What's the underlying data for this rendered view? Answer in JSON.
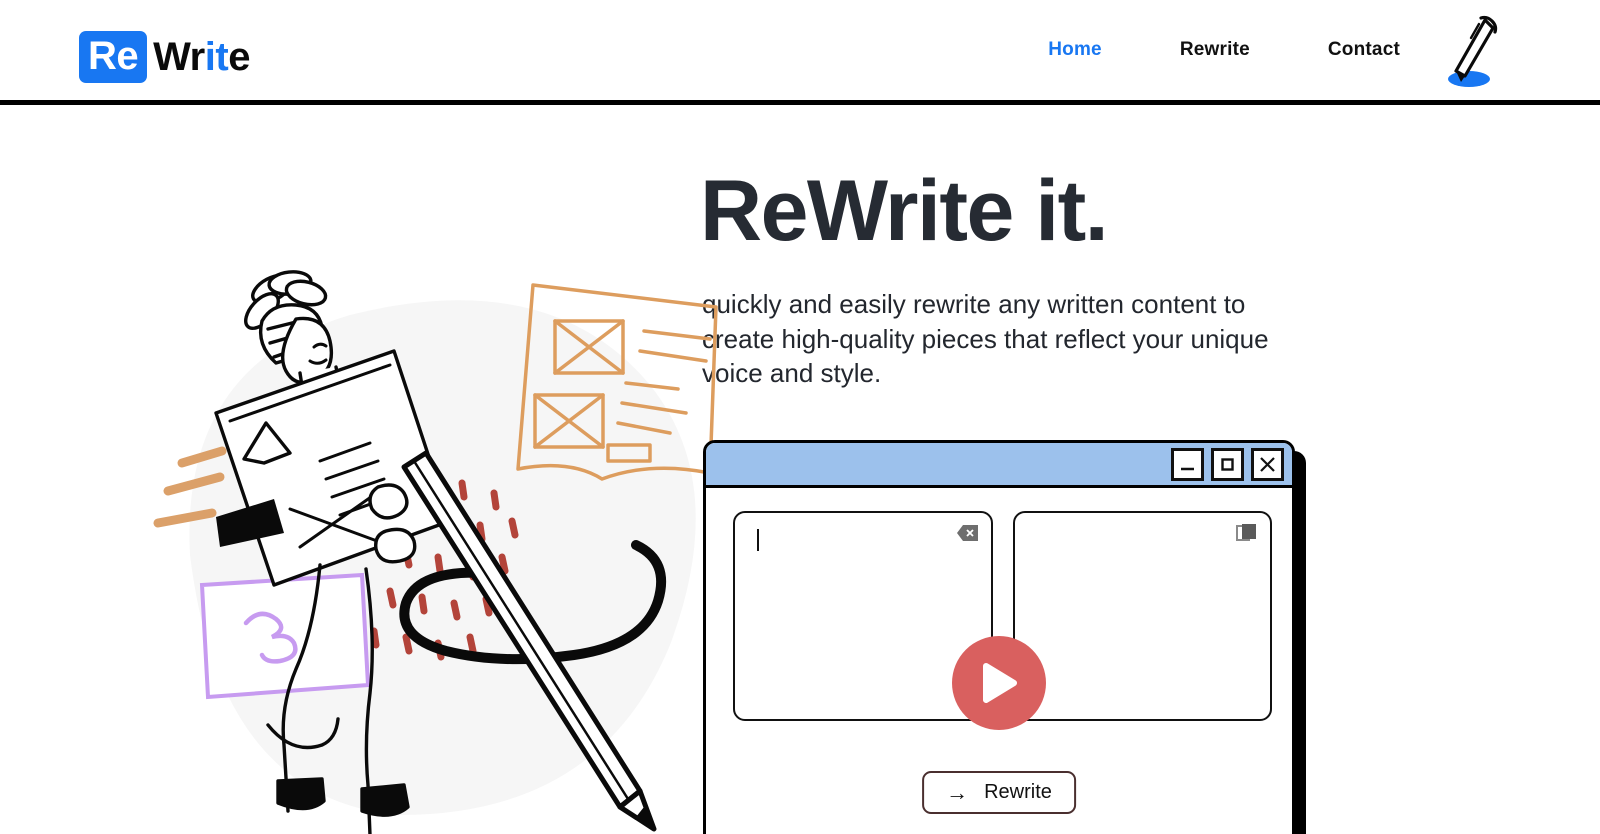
{
  "brand": {
    "badge_text": "Re",
    "name_dark_1": "Wr",
    "name_accent": "it",
    "name_dark_2": "e",
    "accent_color": "#1877f2",
    "pen_icon": "pen-icon"
  },
  "nav": {
    "items": [
      {
        "label": "Home",
        "active": true
      },
      {
        "label": "Rewrite",
        "active": false
      },
      {
        "label": "Contact",
        "active": false
      }
    ]
  },
  "hero": {
    "title": "ReWrite it.",
    "subtitle": "quickly and easily rewrite any written content to create high-quality pieces that reflect your unique voice and style.",
    "title_color": "#262b33"
  },
  "illustration": {
    "name": "woman-with-pencil-illustration",
    "blob_color": "#f6f6f6",
    "accents": {
      "speed_lines": "#dba069",
      "sticky_note": "#c79bf0",
      "paper_sketch": "#dd9d5e",
      "dashes": "#b3443a",
      "ink": "#0a0a0a"
    }
  },
  "app_window": {
    "titlebar_color": "#9cc1ec",
    "controls": [
      {
        "name": "minimize-button",
        "glyph": "minimize"
      },
      {
        "name": "maximize-button",
        "glyph": "maximize"
      },
      {
        "name": "close-button",
        "glyph": "close"
      }
    ],
    "input_panel": {
      "value": "",
      "placeholder": "",
      "icon": "clear-backspace-icon"
    },
    "output_panel": {
      "value": "",
      "placeholder": "",
      "icon": "copy-icon"
    },
    "play_button": {
      "name": "play-button",
      "color": "#d9605f"
    },
    "rewrite_button": {
      "arrow": "→",
      "label": "Rewrite",
      "border_color": "#4a2f2f"
    }
  }
}
